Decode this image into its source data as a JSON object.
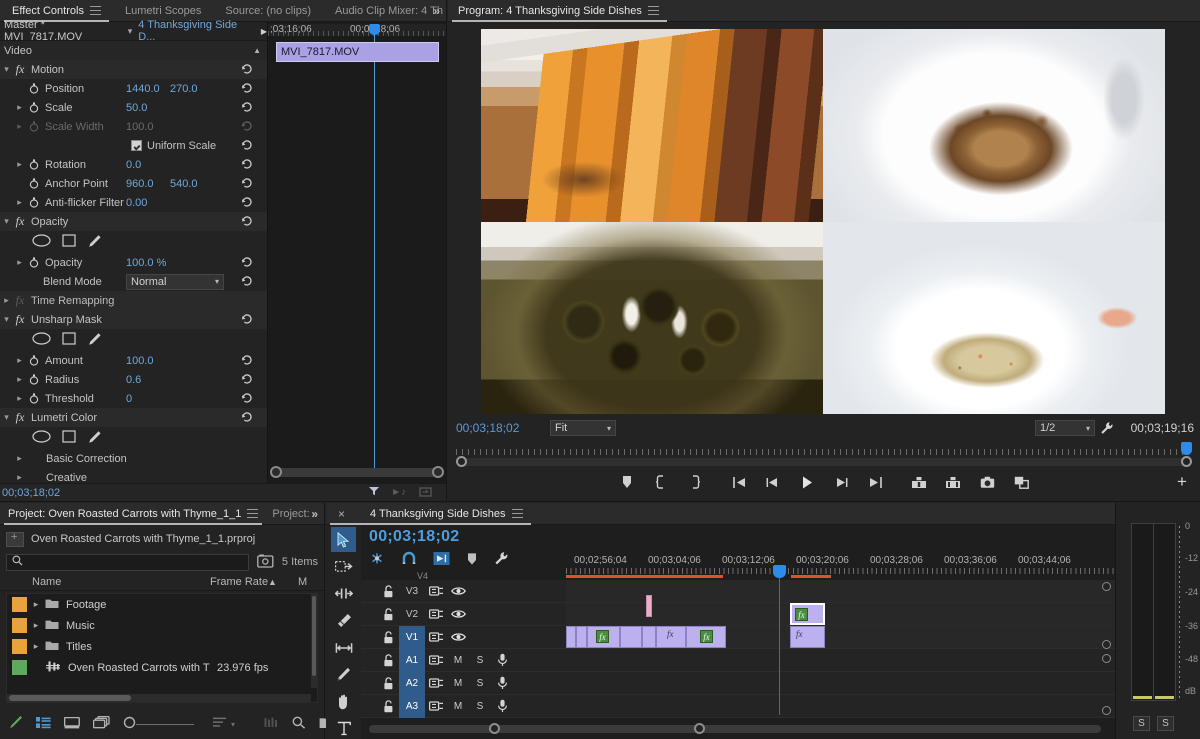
{
  "effect_controls": {
    "tabs": [
      {
        "label": "Effect Controls",
        "active": true,
        "menu": true
      },
      {
        "label": "Lumetri Scopes",
        "active": false,
        "menu": false
      },
      {
        "label": "Source: (no clips)",
        "active": false,
        "menu": false
      },
      {
        "label": "Audio Clip Mixer: 4 Th",
        "active": false,
        "menu": false
      }
    ],
    "overflow": "»",
    "clip_bar": {
      "master": "Master * MVI_7817.MOV",
      "chevron": "⌄",
      "sequence": "4 Thanksgiving Side D...",
      "arrow": "▶"
    },
    "video_header": "Video",
    "groups": [
      {
        "name": "Motion",
        "fx": true,
        "expanded": true,
        "dim": false,
        "shapes": false,
        "properties": [
          {
            "label": "Position",
            "values": [
              "1440.0",
              "270.0"
            ],
            "disclosure": false,
            "stopwatch": true,
            "dim": false
          },
          {
            "label": "Scale",
            "values": [
              "50.0"
            ],
            "disclosure": true,
            "stopwatch": true,
            "dim": false
          },
          {
            "label": "Scale Width",
            "values": [
              "100.0"
            ],
            "disclosure": true,
            "stopwatch": true,
            "dim": true
          },
          {
            "label": "Uniform Scale",
            "values": [],
            "checkbox": true,
            "checked": true,
            "disclosure": false,
            "stopwatch": false,
            "dim": false
          },
          {
            "label": "Rotation",
            "values": [
              "0.0"
            ],
            "disclosure": true,
            "stopwatch": true,
            "dim": false
          },
          {
            "label": "Anchor Point",
            "values": [
              "960.0",
              "540.0"
            ],
            "disclosure": false,
            "stopwatch": true,
            "dim": false
          },
          {
            "label": "Anti-flicker Filter",
            "values": [
              "0.00"
            ],
            "disclosure": true,
            "stopwatch": true,
            "dim": false
          }
        ]
      },
      {
        "name": "Opacity",
        "fx": true,
        "expanded": true,
        "dim": false,
        "shapes": true,
        "properties": [
          {
            "label": "Opacity",
            "values": [
              "100.0 %"
            ],
            "disclosure": true,
            "stopwatch": true,
            "dim": false
          },
          {
            "label": "Blend Mode",
            "values": [],
            "dropdown": "Normal",
            "disclosure": false,
            "stopwatch": false,
            "dim": false
          }
        ]
      },
      {
        "name": "Time Remapping",
        "fx": true,
        "expanded": false,
        "dim": true,
        "shapes": false,
        "properties": []
      },
      {
        "name": "Unsharp Mask",
        "fx": true,
        "expanded": true,
        "dim": false,
        "shapes": true,
        "properties": [
          {
            "label": "Amount",
            "values": [
              "100.0"
            ],
            "disclosure": true,
            "stopwatch": true,
            "dim": false
          },
          {
            "label": "Radius",
            "values": [
              "0.6"
            ],
            "disclosure": true,
            "stopwatch": true,
            "dim": false
          },
          {
            "label": "Threshold",
            "values": [
              "0"
            ],
            "disclosure": true,
            "stopwatch": true,
            "dim": false
          }
        ]
      },
      {
        "name": "Lumetri Color",
        "fx": true,
        "expanded": true,
        "dim": false,
        "shapes": true,
        "properties": [
          {
            "label": "Basic Correction",
            "values": [],
            "disclosure": true,
            "stopwatch": false,
            "dim": false
          },
          {
            "label": "Creative",
            "values": [],
            "disclosure": true,
            "stopwatch": false,
            "dim": false
          }
        ]
      }
    ],
    "mini_timeline": {
      "tick_labels": [
        ";03;16;06",
        "00;0  ;18;06"
      ],
      "clip_name": "MVI_7817.MOV"
    },
    "status_timecode": "00;03;18;02"
  },
  "program": {
    "tab": {
      "label": "Program: 4 Thanksgiving Side Dishes",
      "menu": true
    },
    "timecode_current": "00;03;18;02",
    "fit_label": "Fit",
    "resolution_label": "1/2",
    "timecode_duration": "00;03;19;16",
    "buttons": [
      {
        "name": "add-marker-button",
        "glyph": "marker"
      },
      {
        "name": "mark-in-button",
        "glyph": "in"
      },
      {
        "name": "mark-out-button",
        "glyph": "out"
      },
      {
        "name": "go-to-in-button",
        "glyph": "goin"
      },
      {
        "name": "step-back-button",
        "glyph": "stepback"
      },
      {
        "name": "play-stop-button",
        "glyph": "play"
      },
      {
        "name": "step-forward-button",
        "glyph": "stepfwd"
      },
      {
        "name": "go-to-out-button",
        "glyph": "goout"
      },
      {
        "name": "lift-button",
        "glyph": "lift"
      },
      {
        "name": "extract-button",
        "glyph": "extract"
      },
      {
        "name": "export-frame-button",
        "glyph": "camera"
      },
      {
        "name": "comparison-view-button",
        "glyph": "compare"
      }
    ],
    "plus_button": "+"
  },
  "project": {
    "tabs": [
      {
        "label": "Project: Oven Roasted Carrots with Thyme_1_1",
        "active": true,
        "menu": true
      },
      {
        "label": "Project: ·",
        "active": false,
        "menu": false
      }
    ],
    "overflow": "»",
    "project_file": "Oven Roasted Carrots with Thyme_1_1.prproj",
    "search_placeholder": "",
    "item_count": "5 Items",
    "columns": [
      "Name",
      "Frame Rate",
      "M"
    ],
    "sort_arrow": "▲",
    "rows": [
      {
        "name": "Footage",
        "frame_rate": "",
        "type": "bin",
        "color": "#e8a33d",
        "expandable": true
      },
      {
        "name": "Music",
        "frame_rate": "",
        "type": "bin",
        "color": "#e8a33d",
        "expandable": true
      },
      {
        "name": "Titles",
        "frame_rate": "",
        "type": "bin",
        "color": "#e8a33d",
        "expandable": true
      },
      {
        "name": "Oven Roasted Carrots with T",
        "frame_rate": "23.976 fps",
        "type": "sequence",
        "color": "#5fa85f",
        "expandable": false
      }
    ],
    "toolbar": [
      {
        "name": "new-item-pen-icon"
      },
      {
        "name": "list-view-icon"
      },
      {
        "name": "icon-view-icon"
      },
      {
        "name": "freeform-view-icon"
      },
      {
        "name": "zoom-slider"
      },
      {
        "name": "sort-icon"
      },
      {
        "name": "sort-chevron-icon"
      },
      {
        "name": "automate-to-sequence-icon"
      },
      {
        "name": "find-icon"
      },
      {
        "name": "new-bin-icon"
      }
    ]
  },
  "timeline": {
    "tab": {
      "close": "×",
      "label": "4 Thanksgiving Side Dishes",
      "menu": true
    },
    "timecode": "00;03;18;02",
    "header_buttons": [
      {
        "name": "nest-toggle-icon"
      },
      {
        "name": "snap-magnet-icon"
      },
      {
        "name": "linked-selection-icon"
      },
      {
        "name": "add-marker-icon"
      },
      {
        "name": "timeline-settings-wrench-icon"
      }
    ],
    "tools": [
      {
        "name": "selection-tool",
        "active": true,
        "glyph": "arrow"
      },
      {
        "name": "track-select-forward-tool",
        "active": false,
        "glyph": "trackselect"
      },
      {
        "name": "ripple-edit-tool",
        "active": false,
        "glyph": "ripple"
      },
      {
        "name": "razor-tool",
        "active": false,
        "glyph": "razor"
      },
      {
        "name": "slip-tool",
        "active": false,
        "glyph": "slip"
      },
      {
        "name": "pen-tool",
        "active": false,
        "glyph": "pen"
      },
      {
        "name": "hand-tool",
        "active": false,
        "glyph": "hand"
      },
      {
        "name": "type-tool",
        "active": false,
        "glyph": "type"
      }
    ],
    "ruler_labels": [
      "00;02;56;04",
      "00;03;04;06",
      "00;03;12;06",
      "00;03;20;06",
      "00;03;28;06",
      "00;03;36;06",
      "00;03;44;06"
    ],
    "tracks": [
      {
        "name": "V3",
        "kind": "video",
        "source_patch": "",
        "selected": false,
        "lock": false
      },
      {
        "name": "V2",
        "kind": "video",
        "source_patch": "",
        "selected": false,
        "lock": false
      },
      {
        "name": "V1",
        "kind": "video",
        "source_patch": "V1",
        "selected": true,
        "lock": false
      },
      {
        "name": "A1",
        "kind": "audio",
        "source_patch": "A1",
        "selected": true,
        "lock": false
      },
      {
        "name": "A2",
        "kind": "audio",
        "source_patch": "",
        "selected": true,
        "lock": false
      },
      {
        "name": "A3",
        "kind": "audio",
        "source_patch": "",
        "selected": true,
        "lock": false
      }
    ],
    "audio_labels": {
      "mute": "M",
      "solo": "S"
    }
  },
  "meters": {
    "scale": [
      "0",
      "-12",
      "-24",
      "-36",
      "-48",
      "dB"
    ],
    "solo_left": "S",
    "solo_right": "S"
  },
  "colors": {
    "accent_blue": "#4d9de0",
    "panel_bg": "#232323",
    "tab_bg": "#2b2b2b",
    "clip_purple": "#bcb0ef",
    "selection_blue": "#2f5c8a",
    "bin_orange": "#e8a33d",
    "sequence_green": "#5fa85f",
    "fx_green": "#4c8c3f",
    "render_red": "#e05a3a",
    "transition_pink": "#e9afc8",
    "meter_yellow": "#c8c86a"
  }
}
